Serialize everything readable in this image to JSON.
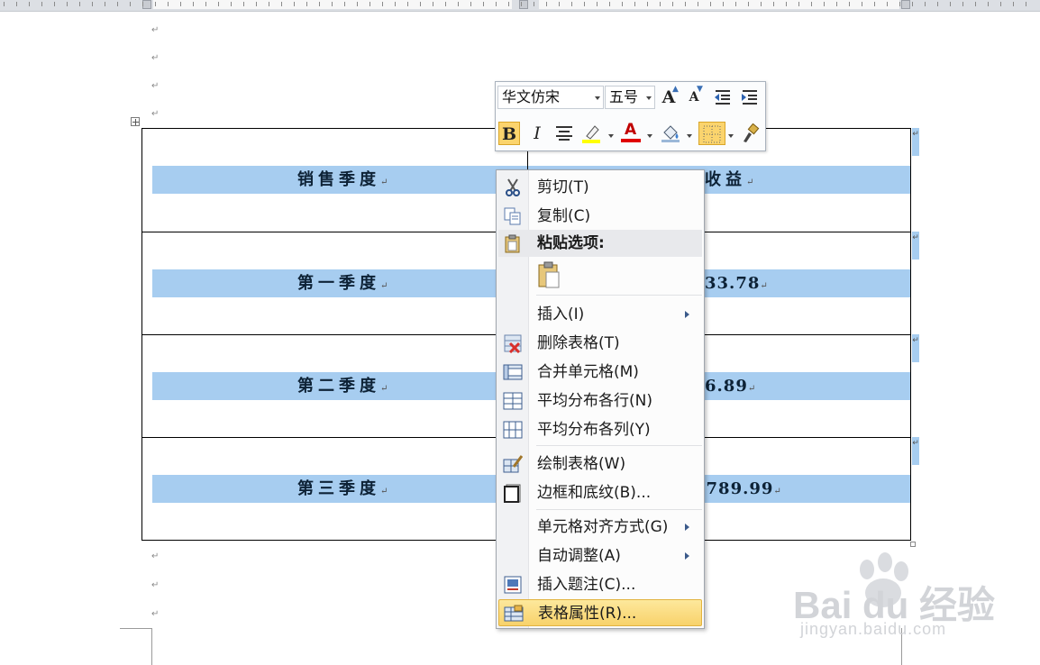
{
  "document": {
    "table": {
      "rows": [
        {
          "left": "销售季度",
          "right": "收益"
        },
        {
          "left": "第一季度",
          "right": "33.78"
        },
        {
          "left": "第二季度",
          "right": "6.89"
        },
        {
          "left": "第三季度",
          "right": "8789.99"
        }
      ],
      "paragraph_mark": "↵"
    }
  },
  "mini_toolbar": {
    "font_name": "华文仿宋",
    "font_size": "五号",
    "grow_font": "A",
    "shrink_font": "A",
    "bold": "B",
    "italic": "I",
    "font_color": "A",
    "highlight_color": "#ffff00",
    "font_color_value": "#e00000"
  },
  "context_menu": {
    "items": [
      {
        "label": "剪切(T)",
        "icon": "scissors-icon"
      },
      {
        "label": "复制(C)",
        "icon": "copy-icon"
      },
      {
        "label": "粘贴选项:",
        "icon": "paste-icon"
      },
      {
        "label": "插入(I)",
        "icon": ""
      },
      {
        "label": "删除表格(T)",
        "icon": "delete-table-icon"
      },
      {
        "label": "合并单元格(M)",
        "icon": "merge-cells-icon"
      },
      {
        "label": "平均分布各行(N)",
        "icon": "distribute-rows-icon"
      },
      {
        "label": "平均分布各列(Y)",
        "icon": "distribute-columns-icon"
      },
      {
        "label": "绘制表格(W)",
        "icon": "draw-table-icon"
      },
      {
        "label": "边框和底纹(B)...",
        "icon": "borders-shading-icon"
      },
      {
        "label": "单元格对齐方式(G)",
        "icon": ""
      },
      {
        "label": "自动调整(A)",
        "icon": ""
      },
      {
        "label": "插入题注(C)...",
        "icon": "insert-caption-icon"
      },
      {
        "label": "表格属性(R)...",
        "icon": "table-properties-icon"
      }
    ]
  },
  "watermark": {
    "logo": "Bai du 经验",
    "url": "jingyan.baidu.com"
  }
}
